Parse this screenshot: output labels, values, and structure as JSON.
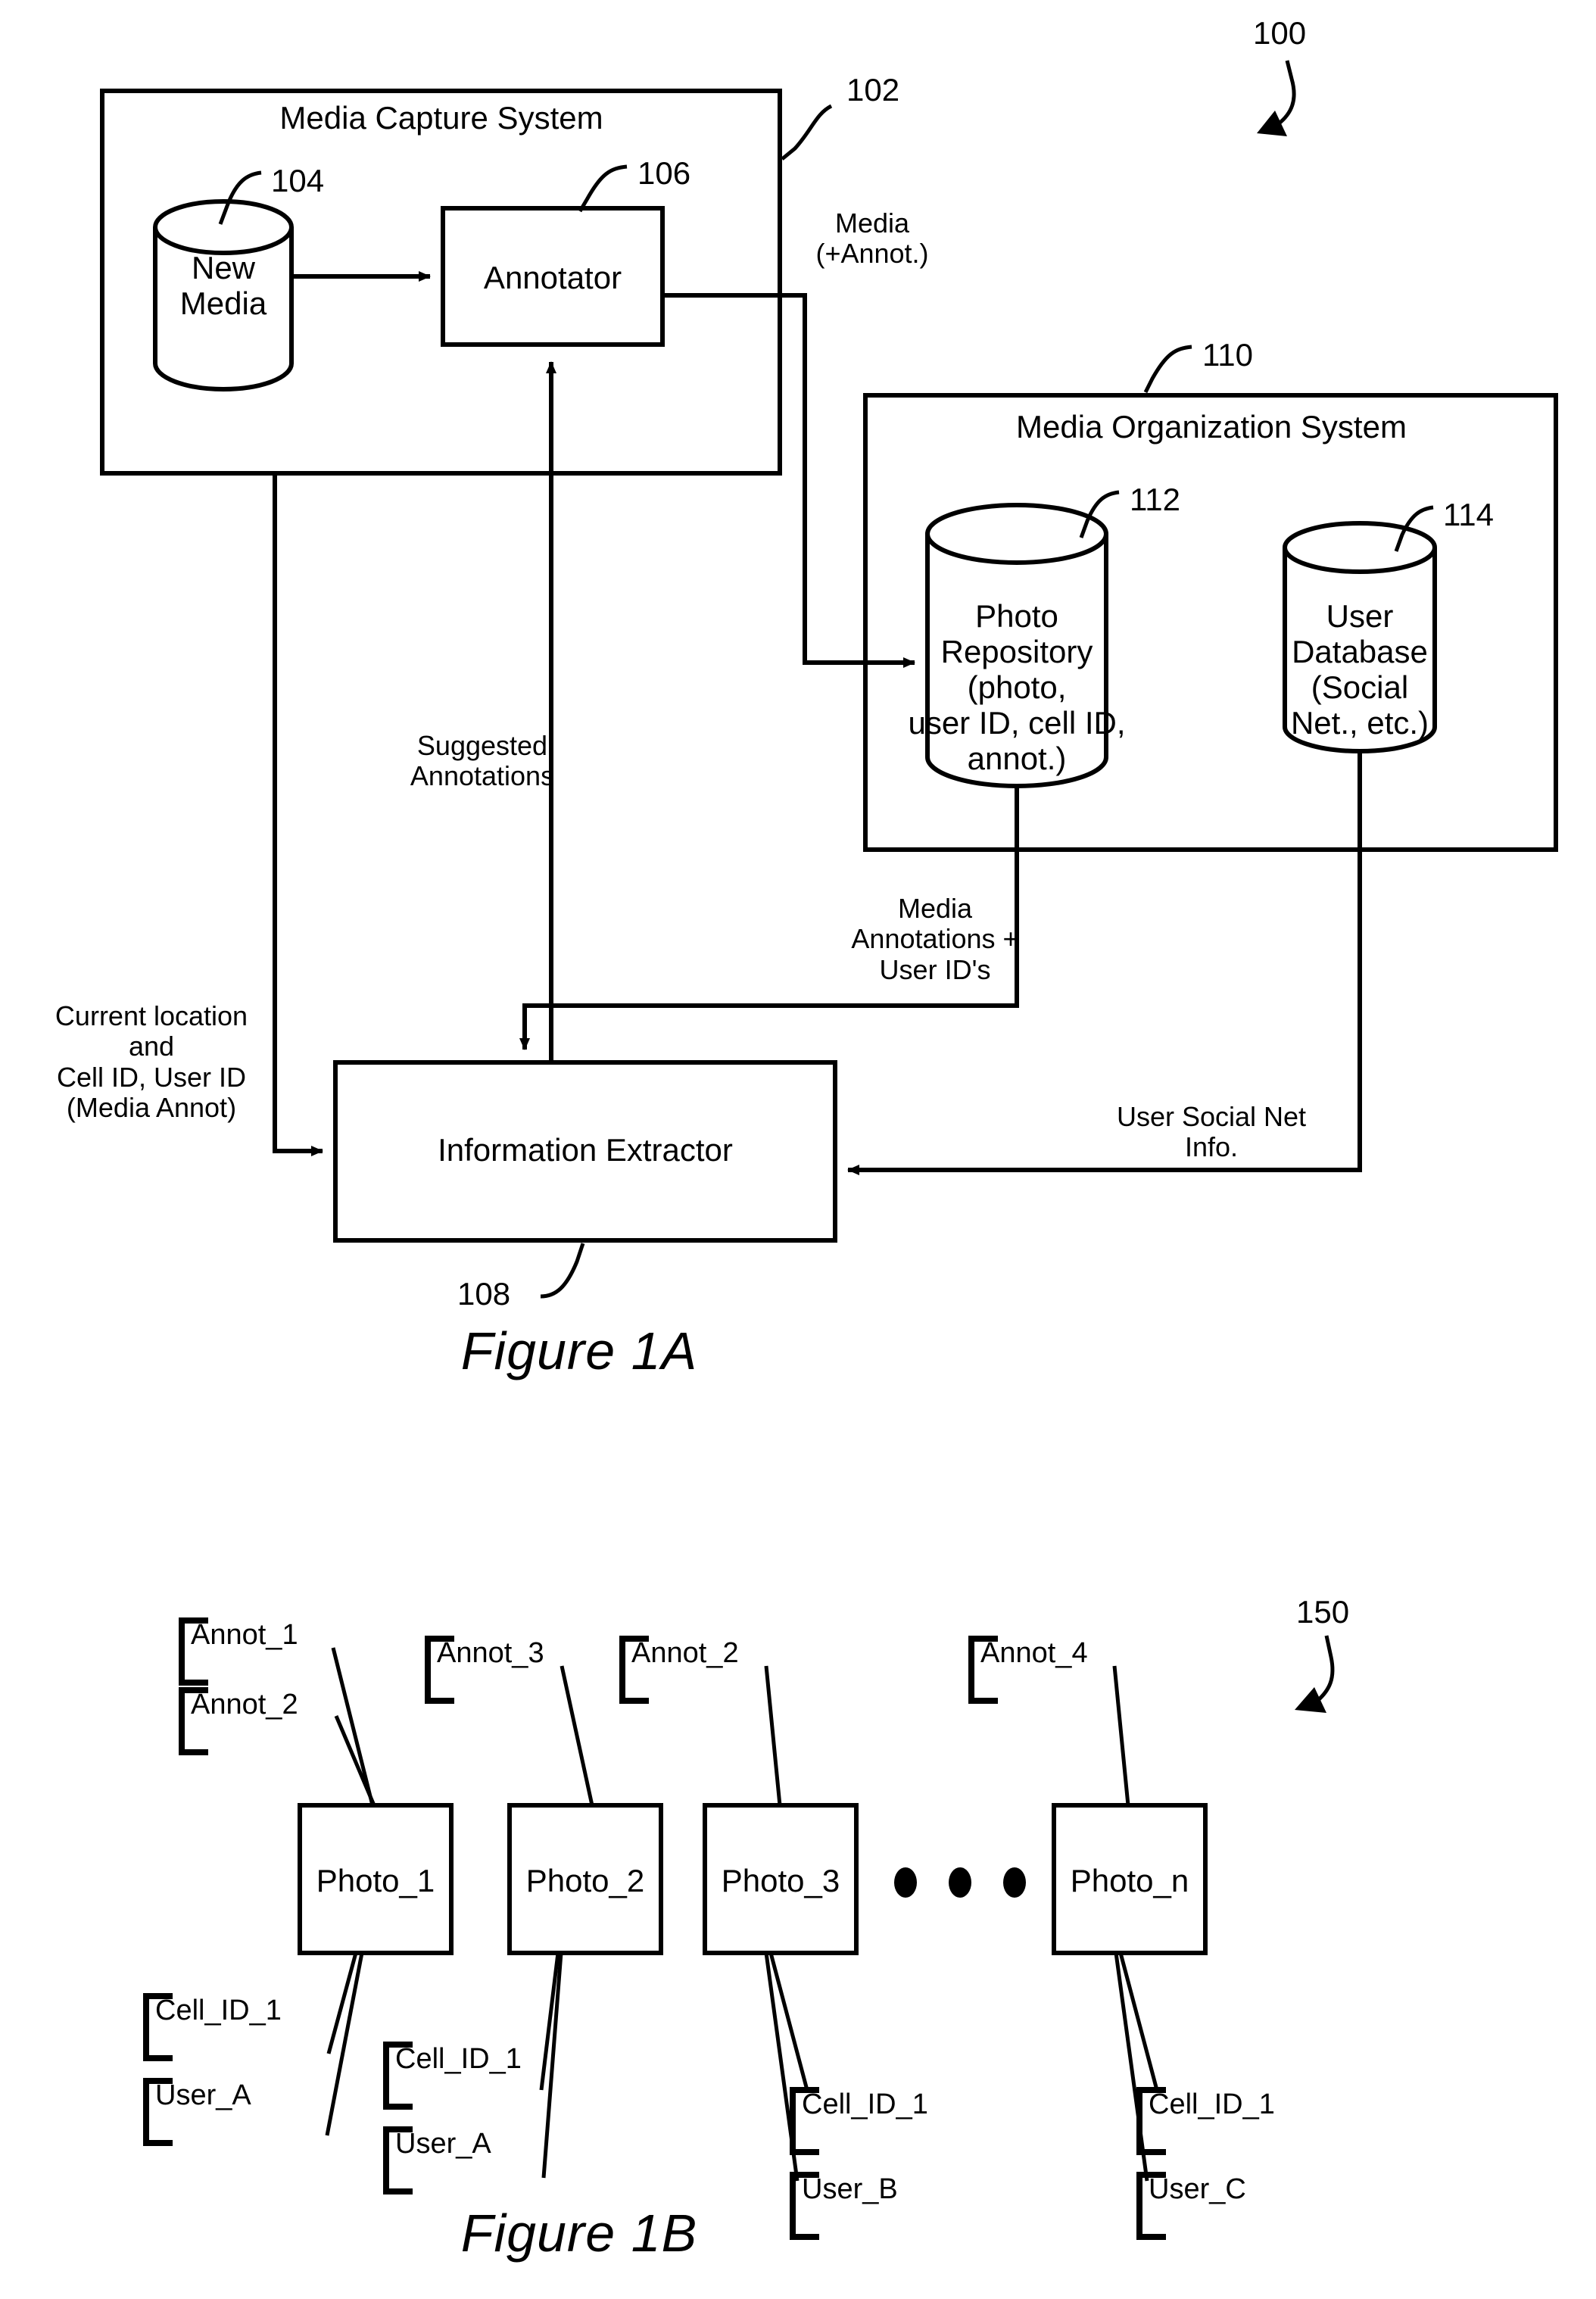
{
  "figures": [
    {
      "id": "figure-1a",
      "caption": "Figure 1A",
      "overall_ref": "100",
      "systems": [
        {
          "id": "media-capture-system",
          "title": "Media Capture System",
          "ref": "102"
        },
        {
          "id": "media-organization-system",
          "title": "Media Organization System",
          "ref": "110"
        }
      ],
      "nodes": [
        {
          "id": "new-media",
          "label": "New\nMedia",
          "ref": "104",
          "shape": "cylinder"
        },
        {
          "id": "annotator",
          "label": "Annotator",
          "ref": "106",
          "shape": "box"
        },
        {
          "id": "information-extractor",
          "label": "Information Extractor",
          "ref": "108",
          "shape": "box"
        },
        {
          "id": "photo-repository",
          "label": "Photo\nRepository\n(photo,\nuser ID, cell ID,\nannot.)",
          "ref": "112",
          "shape": "cylinder"
        },
        {
          "id": "user-database",
          "label": "User\nDatabase\n(Social\nNet., etc.)",
          "ref": "114",
          "shape": "cylinder"
        }
      ],
      "edge_labels": [
        {
          "id": "media-annot",
          "text": "Media\n(+Annot.)"
        },
        {
          "id": "suggested-annotations",
          "text": "Suggested\nAnnotations"
        },
        {
          "id": "current-location",
          "text": "Current location\nand\nCell ID, User ID\n(Media Annot)"
        },
        {
          "id": "media-annotations-user-ids",
          "text": "Media\nAnnotations +\nUser ID's"
        },
        {
          "id": "user-social-net-info",
          "text": "User Social Net\nInfo."
        }
      ]
    },
    {
      "id": "figure-1b",
      "caption": "Figure 1B",
      "overall_ref": "150",
      "ellipsis": "● ● ●",
      "photos": [
        {
          "id": "photo-1",
          "label": "Photo_1",
          "annotations": [
            "Annot_1",
            "Annot_2"
          ],
          "attributes": [
            "Cell_ID_1",
            "User_A"
          ]
        },
        {
          "id": "photo-2",
          "label": "Photo_2",
          "annotations": [
            "Annot_3"
          ],
          "attributes": [
            "Cell_ID_1",
            "User_A"
          ]
        },
        {
          "id": "photo-3",
          "label": "Photo_3",
          "annotations": [
            "Annot_2"
          ],
          "attributes": [
            "Cell_ID_1",
            "User_B"
          ]
        },
        {
          "id": "photo-n",
          "label": "Photo_n",
          "annotations": [
            "Annot_4"
          ],
          "attributes": [
            "Cell_ID_1",
            "User_C"
          ]
        }
      ]
    }
  ],
  "colors": {
    "ink": "#000000",
    "paper": "#ffffff"
  }
}
